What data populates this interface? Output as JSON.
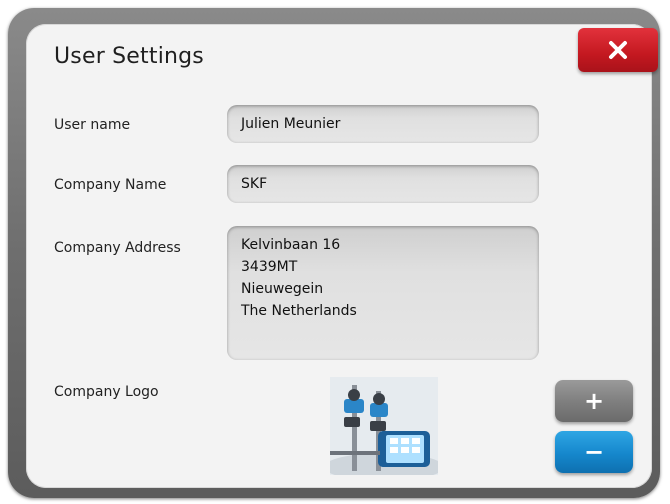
{
  "dialog": {
    "title": "User Settings",
    "close_icon": "close-icon"
  },
  "fields": {
    "user_name": {
      "label": "User name",
      "value": "Julien Meunier"
    },
    "company_name": {
      "label": "Company Name",
      "value": "SKF"
    },
    "company_address": {
      "label": "Company Address",
      "lines": [
        "Kelvinbaan 16",
        "3439MT",
        "Nieuwegein",
        "The Netherlands"
      ]
    },
    "company_logo": {
      "label": "Company Logo"
    }
  },
  "buttons": {
    "add_label": "+",
    "remove_label": "−"
  },
  "colors": {
    "close": "#c41820",
    "add": "#7d7d7d",
    "remove": "#1587cc"
  }
}
